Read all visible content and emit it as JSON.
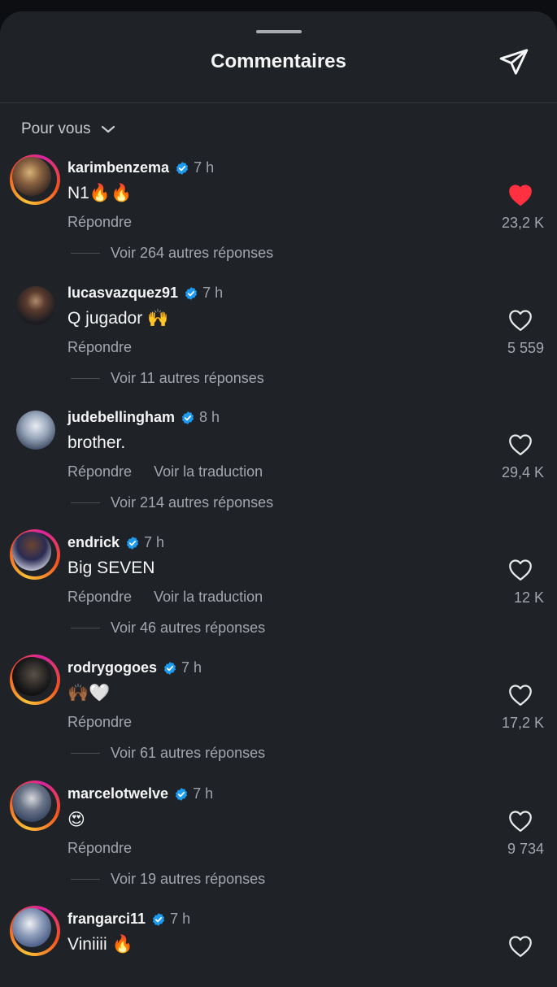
{
  "header": {
    "title": "Commentaires",
    "share_icon": "send-icon"
  },
  "sort": {
    "label": "Pour vous"
  },
  "colors": {
    "background": "#1f2226",
    "liked": "#ff3040",
    "verified": "#1d9bf0"
  },
  "comments": [
    {
      "username": "karimbenzema",
      "time": "7 h",
      "text": "N1🔥🔥",
      "reply": "Répondre",
      "translate": "",
      "likes": "23,2 K",
      "liked": true,
      "replies": "Voir 264 autres réponses"
    },
    {
      "username": "lucasvazquez91",
      "time": "7 h",
      "text": "Q jugador 🙌",
      "reply": "Répondre",
      "translate": "",
      "likes": "5 559",
      "liked": false,
      "replies": "Voir 11 autres réponses"
    },
    {
      "username": "judebellingham",
      "time": "8 h",
      "text": "brother.",
      "reply": "Répondre",
      "translate": "Voir la traduction",
      "likes": "29,4 K",
      "liked": false,
      "replies": "Voir 214 autres réponses"
    },
    {
      "username": "endrick",
      "time": "7 h",
      "text": "Big SEVEN",
      "reply": "Répondre",
      "translate": "Voir la traduction",
      "likes": "12 K",
      "liked": false,
      "replies": "Voir 46 autres réponses"
    },
    {
      "username": "rodrygogoes",
      "time": "7 h",
      "text": "🙌🏾🤍",
      "reply": "Répondre",
      "translate": "",
      "likes": "17,2 K",
      "liked": false,
      "replies": "Voir 61 autres réponses"
    },
    {
      "username": "marcelotwelve",
      "time": "7 h",
      "text": "😍",
      "reply": "Répondre",
      "translate": "",
      "likes": "9 734",
      "liked": false,
      "replies": "Voir 19 autres réponses"
    },
    {
      "username": "frangarci11",
      "time": "7 h",
      "text": "Viniiii 🔥",
      "reply": "",
      "translate": "",
      "likes": "",
      "liked": false,
      "replies": ""
    }
  ]
}
